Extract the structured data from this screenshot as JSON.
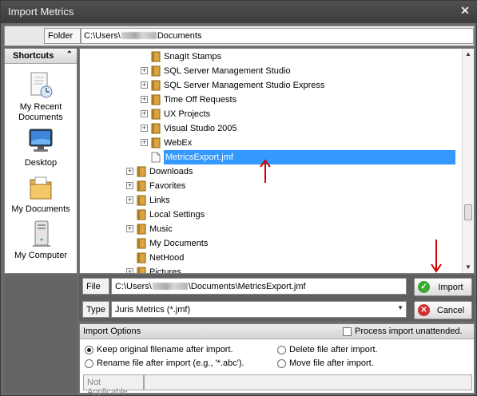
{
  "window": {
    "title": "Import Metrics",
    "close_glyph": "✕"
  },
  "folder": {
    "label": "Folder",
    "path_prefix": "C:\\Users\\",
    "path_suffix": "Documents"
  },
  "shortcuts": {
    "header": "Shortcuts",
    "collapse_glyph": "⌃",
    "items": [
      {
        "label_line1": "My Recent",
        "label_line2": "Documents",
        "icon": "recent-documents-icon"
      },
      {
        "label_line1": "Desktop",
        "label_line2": "",
        "icon": "desktop-icon"
      },
      {
        "label_line1": "My Documents",
        "label_line2": "",
        "icon": "my-documents-icon"
      },
      {
        "label_line1": "My Computer",
        "label_line2": "",
        "icon": "my-computer-icon"
      }
    ]
  },
  "tree": {
    "items": [
      {
        "label": "SnagIt Stamps",
        "expandable": false,
        "type": "folder"
      },
      {
        "label": "SQL Server Management Studio",
        "expandable": true,
        "type": "folder"
      },
      {
        "label": "SQL Server Management Studio Express",
        "expandable": true,
        "type": "folder"
      },
      {
        "label": "Time Off Requests",
        "expandable": true,
        "type": "folder"
      },
      {
        "label": "UX Projects",
        "expandable": true,
        "type": "folder"
      },
      {
        "label": "Visual Studio 2005",
        "expandable": true,
        "type": "folder"
      },
      {
        "label": "WebEx",
        "expandable": true,
        "type": "folder"
      },
      {
        "label": "MetricsExport.jmf",
        "expandable": false,
        "type": "file",
        "selected": true
      },
      {
        "label": "Downloads",
        "expandable": true,
        "type": "folder"
      },
      {
        "label": "Favorites",
        "expandable": true,
        "type": "folder"
      },
      {
        "label": "Links",
        "expandable": true,
        "type": "folder"
      },
      {
        "label": "Local Settings",
        "expandable": false,
        "type": "folder"
      },
      {
        "label": "Music",
        "expandable": true,
        "type": "folder"
      },
      {
        "label": "My Documents",
        "expandable": false,
        "type": "folder"
      },
      {
        "label": "NetHood",
        "expandable": false,
        "type": "folder"
      },
      {
        "label": "Pictures",
        "expandable": true,
        "type": "folder"
      }
    ]
  },
  "file": {
    "label": "File",
    "path_prefix": "C:\\Users\\",
    "path_suffix": "\\Documents\\MetricsExport.jmf"
  },
  "type": {
    "label": "Type",
    "value": "Juris Metrics (*.jmf)"
  },
  "buttons": {
    "import": "Import",
    "cancel": "Cancel"
  },
  "options": {
    "header": "Import Options",
    "unattended": "Process import unattended.",
    "keep_name": "Keep original filename after import.",
    "rename": "Rename file after import (e.g., '*.abc').",
    "delete": "Delete file after import.",
    "move": "Move file after import.",
    "not_applicable": "Not Applicable"
  },
  "colors": {
    "selection": "#3399ff",
    "annotation_arrow": "#d40000",
    "import_icon": "#3aa832",
    "cancel_icon": "#d23030",
    "folder": "#d9a441"
  }
}
